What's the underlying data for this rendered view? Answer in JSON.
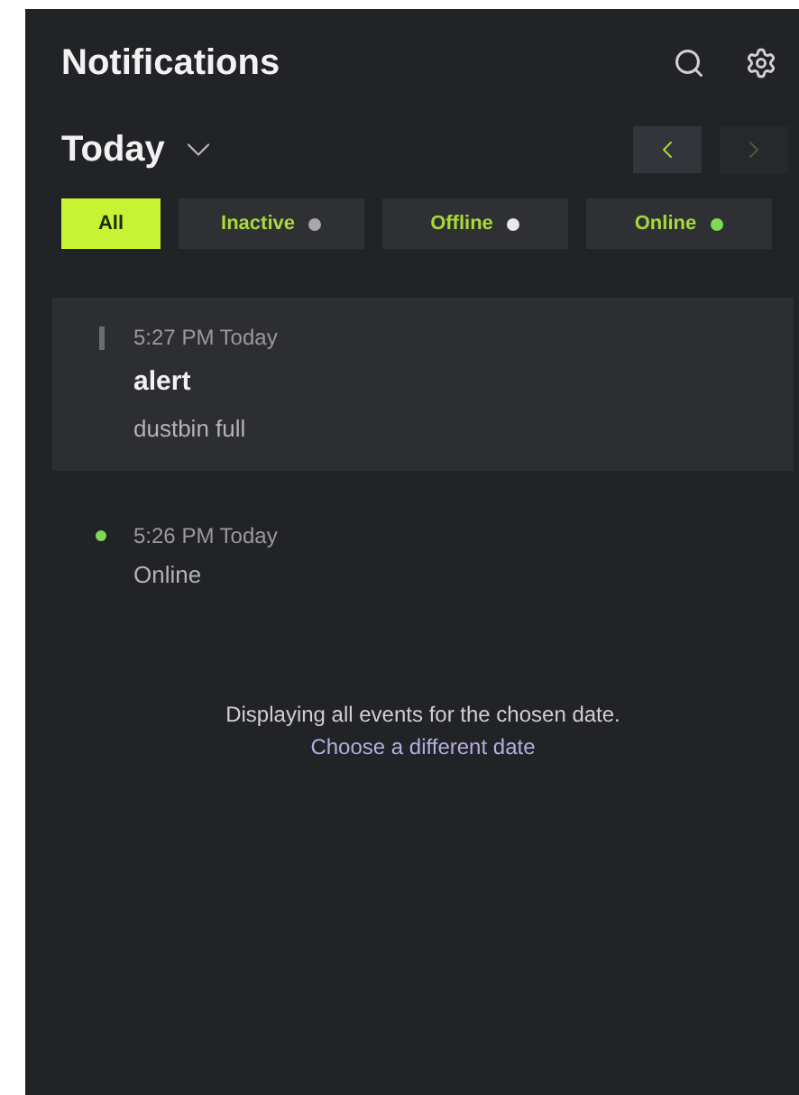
{
  "header": {
    "title": "Notifications"
  },
  "date_picker": {
    "label": "Today",
    "expanded": false,
    "prev_disabled": false,
    "next_disabled": true
  },
  "filters": [
    {
      "label": "All",
      "selected": true
    },
    {
      "label": "Inactive",
      "selected": false,
      "color": "#a8a8a8"
    },
    {
      "label": "Offline",
      "selected": false,
      "color": "#e8e8e8"
    },
    {
      "label": "Online",
      "selected": false,
      "color": "#7ed957"
    }
  ],
  "events": [
    {
      "time": "5:27 PM Today",
      "title": "alert",
      "detail": "dustbin full",
      "kind": "bar",
      "color": "#6b6c70",
      "selected": true
    },
    {
      "time": "5:26 PM Today",
      "detail": "Online",
      "kind": "dot",
      "color": "#7ed957",
      "selected": false
    }
  ],
  "footer": {
    "message": "Displaying all events for the chosen date.",
    "link": "Choose a different date"
  }
}
